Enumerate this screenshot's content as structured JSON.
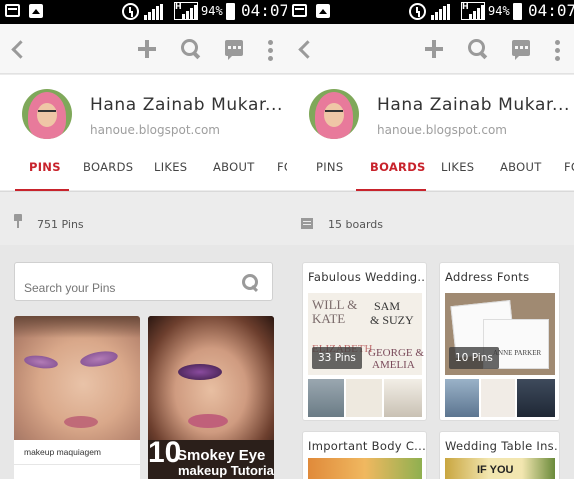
{
  "status_bar": {
    "battery": "94%",
    "time": "04:07",
    "network": "H"
  },
  "profile": {
    "name": "Hana Zainab Mukar...",
    "url": "hanoue.blogspot.com"
  },
  "tabs": [
    "PINS",
    "BOARDS",
    "LIKES",
    "ABOUT",
    "FO"
  ],
  "left_screen": {
    "active_tab": "PINS",
    "stats": "751 Pins",
    "search_placeholder": "Search your Pins",
    "pins": [
      {
        "caption": "makeup maquiagem"
      },
      {
        "overlay_number": "10",
        "overlay_line1": "Smokey Eye",
        "overlay_line2": "makeup Tutorials"
      }
    ]
  },
  "right_screen": {
    "active_tab": "BOARDS",
    "stats": "15 boards",
    "boards": [
      {
        "title": "Fabulous Wedding...",
        "pin_count": "33 Pins",
        "cover_words": [
          "WILL &",
          "KATE",
          "SAM",
          "& SUZY",
          "ELIZABETH",
          "GEORGE &",
          "AMELIA"
        ]
      },
      {
        "title": "Address Fonts",
        "pin_count": "10 Pins",
        "cover_words": [
          "ANNE PARKER"
        ]
      },
      {
        "title": "Important Body C..."
      },
      {
        "title": "Wedding Table Ins...",
        "cover_words": [
          "IF YOU"
        ]
      }
    ]
  },
  "colors": {
    "accent": "#c8232c",
    "icon_gray": "#9a9a9a",
    "background": "#ececec"
  },
  "icons": [
    "back-arrow-icon",
    "plus-icon",
    "search-icon",
    "message-icon",
    "more-vert-icon",
    "pin-icon",
    "board-icon"
  ]
}
